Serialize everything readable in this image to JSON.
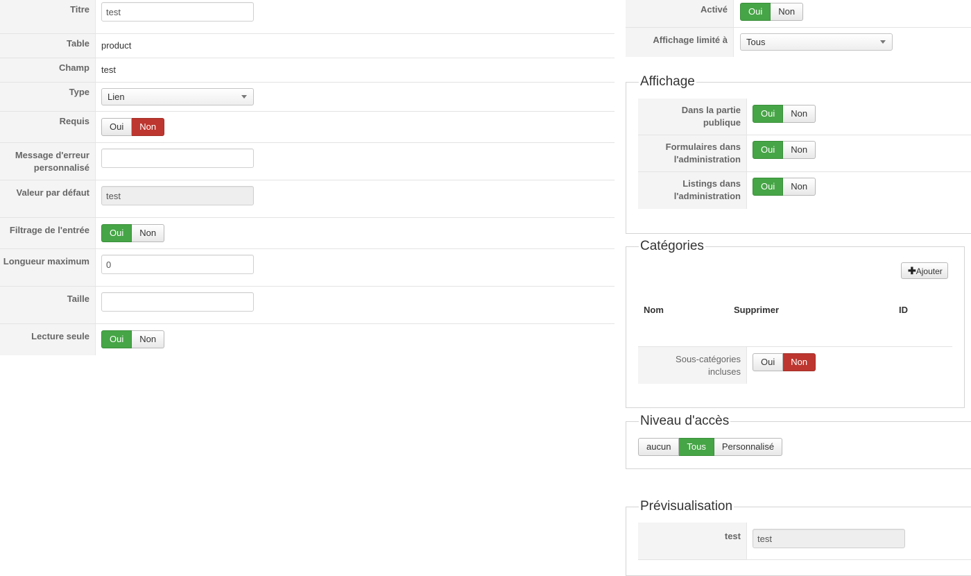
{
  "form": {
    "titre": {
      "label": "Titre",
      "value": "test"
    },
    "table": {
      "label": "Table",
      "value": "product"
    },
    "champ": {
      "label": "Champ",
      "value": "test"
    },
    "type": {
      "label": "Type",
      "value": "Lien"
    },
    "requis": {
      "label": "Requis",
      "yes": "Oui",
      "no": "Non",
      "selected": "Non"
    },
    "message_erreur": {
      "label_line1": "Message d'erreur",
      "label_line2": "personnalisé",
      "value": ""
    },
    "valeur_defaut": {
      "label": "Valeur par défaut",
      "value": "test"
    },
    "filtrage": {
      "label": "Filtrage de l'entrée",
      "yes": "Oui",
      "no": "Non",
      "selected": "Oui"
    },
    "longueur": {
      "label": "Longueur maximum",
      "value": "0"
    },
    "taille": {
      "label": "Taille",
      "value": ""
    },
    "lecture_seule": {
      "label": "Lecture seule",
      "yes": "Oui",
      "no": "Non",
      "selected": "Oui"
    }
  },
  "right": {
    "active": {
      "label": "Activé",
      "yes": "Oui",
      "no": "Non",
      "selected": "Oui"
    },
    "affichage_limite": {
      "label": "Affichage limité à",
      "value": "Tous"
    },
    "affichage": {
      "legend": "Affichage",
      "rows": [
        {
          "line1": "Dans la partie",
          "line2": "publique",
          "yes": "Oui",
          "no": "Non",
          "selected": "Oui"
        },
        {
          "line1": "Formulaires dans",
          "line2": "l'administration",
          "yes": "Oui",
          "no": "Non",
          "selected": "Oui"
        },
        {
          "line1": "Listings dans",
          "line2": "l'administration",
          "yes": "Oui",
          "no": "Non",
          "selected": "Oui"
        }
      ]
    },
    "categories": {
      "legend": "Catégories",
      "add_button": "Ajouter",
      "columns": [
        "Nom",
        "Supprimer",
        "ID"
      ],
      "sous_categories": {
        "line1": "Sous-catégories",
        "line2": "incluses",
        "yes": "Oui",
        "no": "Non",
        "selected": "Non"
      }
    },
    "niveau_acces": {
      "legend": "Niveau d'accès",
      "options": [
        "aucun",
        "Tous",
        "Personnalisé"
      ],
      "selected": "Tous"
    },
    "previsualisation": {
      "legend": "Prévisualisation",
      "label": "test",
      "value": "test"
    }
  },
  "colors": {
    "green": "#46a546",
    "red": "#bd362f",
    "label_bg": "#f4f4f4"
  },
  "icons": {
    "add": "plus-icon",
    "select": "caret-down-icon"
  }
}
